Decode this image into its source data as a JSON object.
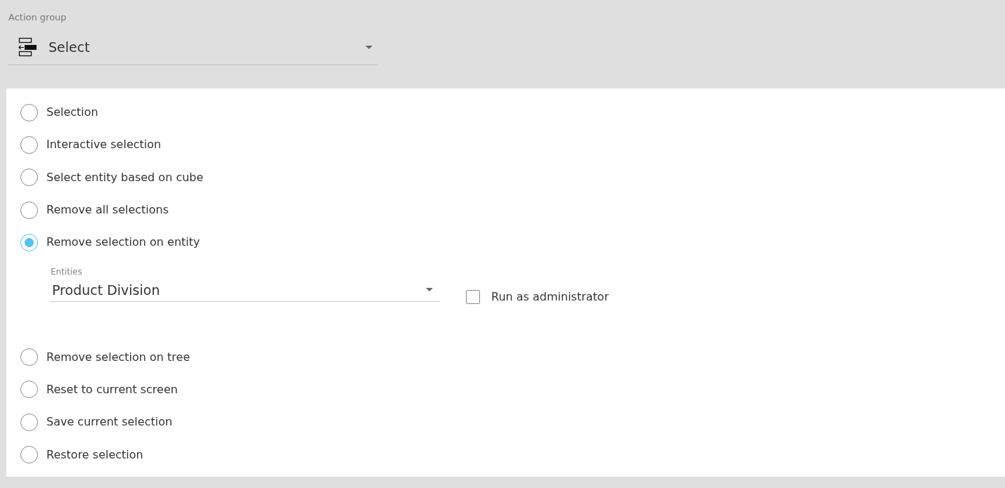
{
  "action_group": {
    "label": "Action group",
    "value": "Select"
  },
  "options": [
    {
      "label": "Selection",
      "selected": false
    },
    {
      "label": "Interactive selection",
      "selected": false
    },
    {
      "label": "Select entity based on cube",
      "selected": false
    },
    {
      "label": "Remove all selections",
      "selected": false
    },
    {
      "label": "Remove selection on entity",
      "selected": true,
      "details": {
        "entities_label": "Entities",
        "entities_value": "Product Division",
        "run_as_admin": {
          "label": "Run as administrator",
          "checked": false
        }
      }
    },
    {
      "label": "Remove selection on tree",
      "selected": false
    },
    {
      "label": "Reset to current screen",
      "selected": false
    },
    {
      "label": "Save current selection",
      "selected": false
    },
    {
      "label": "Restore selection",
      "selected": false
    }
  ]
}
